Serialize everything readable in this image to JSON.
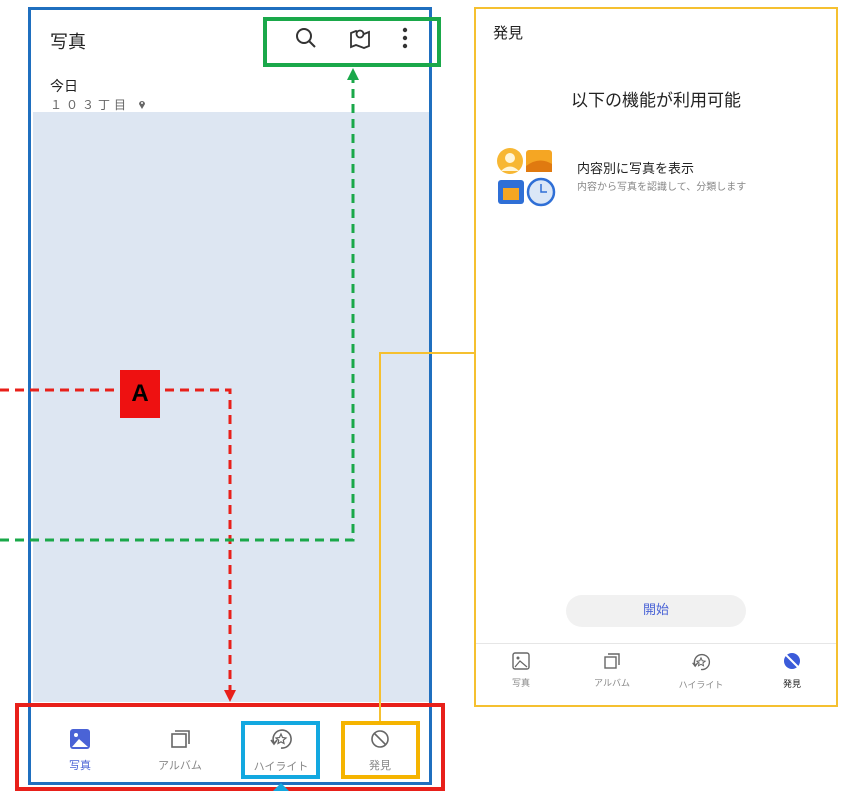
{
  "left_screen": {
    "title": "写真",
    "actions": [
      {
        "icon": "search-icon"
      },
      {
        "icon": "map-icon"
      },
      {
        "icon": "more-vertical-icon"
      }
    ],
    "date_header": "今日",
    "location": "１０３丁目"
  },
  "left_nav": {
    "items": [
      {
        "label": "写真",
        "icon": "photo-icon",
        "active": true
      },
      {
        "label": "アルバム",
        "icon": "album-icon",
        "active": false
      },
      {
        "label": "ハイライト",
        "icon": "highlight-icon",
        "active": false
      },
      {
        "label": "発見",
        "icon": "discover-icon",
        "active": false
      }
    ]
  },
  "annotation": {
    "label_a": "A",
    "colors": {
      "red": "#e8201a",
      "green": "#1aa84a",
      "blue": "#13a8e0",
      "yellow": "#f5b400",
      "frame_blue": "#1f6fbf"
    }
  },
  "right_screen": {
    "title": "発見",
    "heading": "以下の機能が利用可能",
    "feature_title": "内容別に写真を表示",
    "feature_desc": "内容から写真を認識して、分類します",
    "start_button": "開始"
  },
  "right_nav": {
    "items": [
      {
        "label": "写真",
        "icon": "photo-icon",
        "active": false
      },
      {
        "label": "アルバム",
        "icon": "album-icon",
        "active": false
      },
      {
        "label": "ハイライト",
        "icon": "highlight-icon",
        "active": false
      },
      {
        "label": "発見",
        "icon": "discover-icon",
        "active": true
      }
    ]
  },
  "accent_color": "#4a63d6"
}
